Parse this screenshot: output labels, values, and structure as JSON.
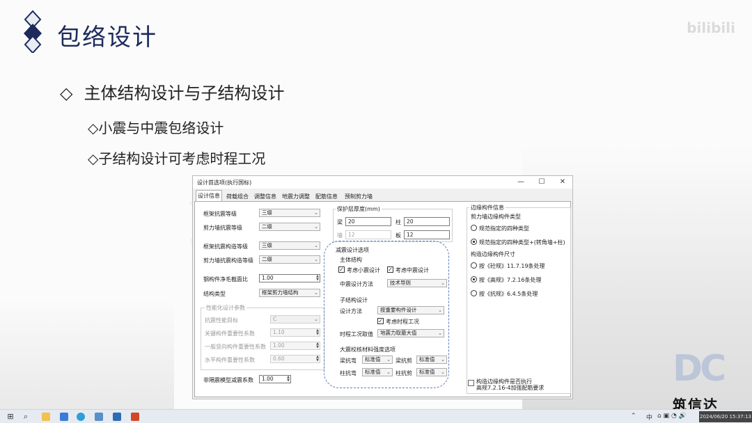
{
  "slide": {
    "title": "包络设计",
    "bullet1": "主体结构设计与子结构设计",
    "bullet2a": "◇小震与中震包络设计",
    "bullet2b": "◇子结构设计可考虑时程工况",
    "diamond": "◇",
    "bili": "bilibili",
    "watermark": "筑信达",
    "dc_logo": "DC",
    "brand": "筑信达"
  },
  "dialog": {
    "title": "设计首选项(执行国标)",
    "min_glyph": "—",
    "max_glyph": "☐",
    "close_glyph": "✕",
    "tabs": [
      "设计信息",
      "荷载组合",
      "调整信息",
      "地震力调整",
      "配筋信息",
      "预制剪力墙"
    ],
    "left": {
      "frame_seismic_label": "框架抗震等级",
      "frame_seismic_value": "三级",
      "wall_seismic_label": "剪力墙抗震等级",
      "wall_seismic_value": "二级",
      "frame_measure_label": "框架抗震构造等级",
      "frame_measure_value": "三级",
      "wall_measure_label": "剪力墙抗震构造等级",
      "wall_measure_value": "二级",
      "steel_ratio_label": "钢构件净毛截面比",
      "steel_ratio_value": "1.00",
      "struct_type_label": "结构类型",
      "struct_type_value": "框架剪力墙结构",
      "perf_group_label": "性能化设计参数",
      "perf_target_label": "抗震性能目标",
      "perf_target_value": "C",
      "key_factor_label": "关键构件重要性系数",
      "key_factor_value": "1.10",
      "normal_factor_label": "一般竖向构件重要性系数",
      "normal_factor_value": "1.00",
      "horiz_factor_label": "水平构件重要性系数",
      "horiz_factor_value": "0.60",
      "isolation_label": "非隔震模型减震系数",
      "isolation_value": "1.00"
    },
    "middle": {
      "cover_group": "保护层厚度(mm)",
      "beam_label": "梁",
      "beam_value": "20",
      "column_label": "柱",
      "column_value": "20",
      "wall_label": "墙",
      "wall_value": "12",
      "slab_label": "板",
      "slab_value": "12",
      "seismic_group": "减震设计选项",
      "main_struct_label": "主体结构",
      "minor_quake_label": "考虑小震设计",
      "mid_quake_label": "考虑中震设计",
      "mid_method_label": "中震设计方法",
      "mid_method_value": "技术导则",
      "sub_struct_label": "子结构设计",
      "design_method_label": "设计方法",
      "design_method_value": "按重要构件设计",
      "time_history_label": "考虑时程工况",
      "th_value_label": "时程工况取值",
      "th_value_value": "地震力取最大值",
      "material_group": "大震校核材料强度选项",
      "beam_flex_label": "梁抗弯",
      "beam_flex_value": "标准值",
      "beam_shear_label": "梁抗剪",
      "beam_shear_value": "标准值",
      "col_flex_label": "柱抗弯",
      "col_flex_value": "标准值",
      "col_shear_label": "柱抗剪",
      "col_shear_value": "标准值"
    },
    "right": {
      "group": "边缘构件信息",
      "wall_type_label": "剪力墙边缘构件类型",
      "opt1": "规范指定的四种类型",
      "opt2": "规范指定的四种类型+(转角墙+柱)",
      "size_label": "构造边缘构件尺寸",
      "size1": "按《砼规》11.7.19条处理",
      "size2": "按《高规》7.2.16条处理",
      "size3": "按《抗规》6.4.5条处理",
      "bottom_chk": "构造边缘构件是否执行",
      "bottom_chk2": "高规7.2.16-4加强配筋要求"
    }
  },
  "taskbar": {
    "clock": "2024/06/20 15:37:13",
    "tray_ime": "中",
    "tray_icons": "⌂  ▣  ◔  🔊"
  }
}
